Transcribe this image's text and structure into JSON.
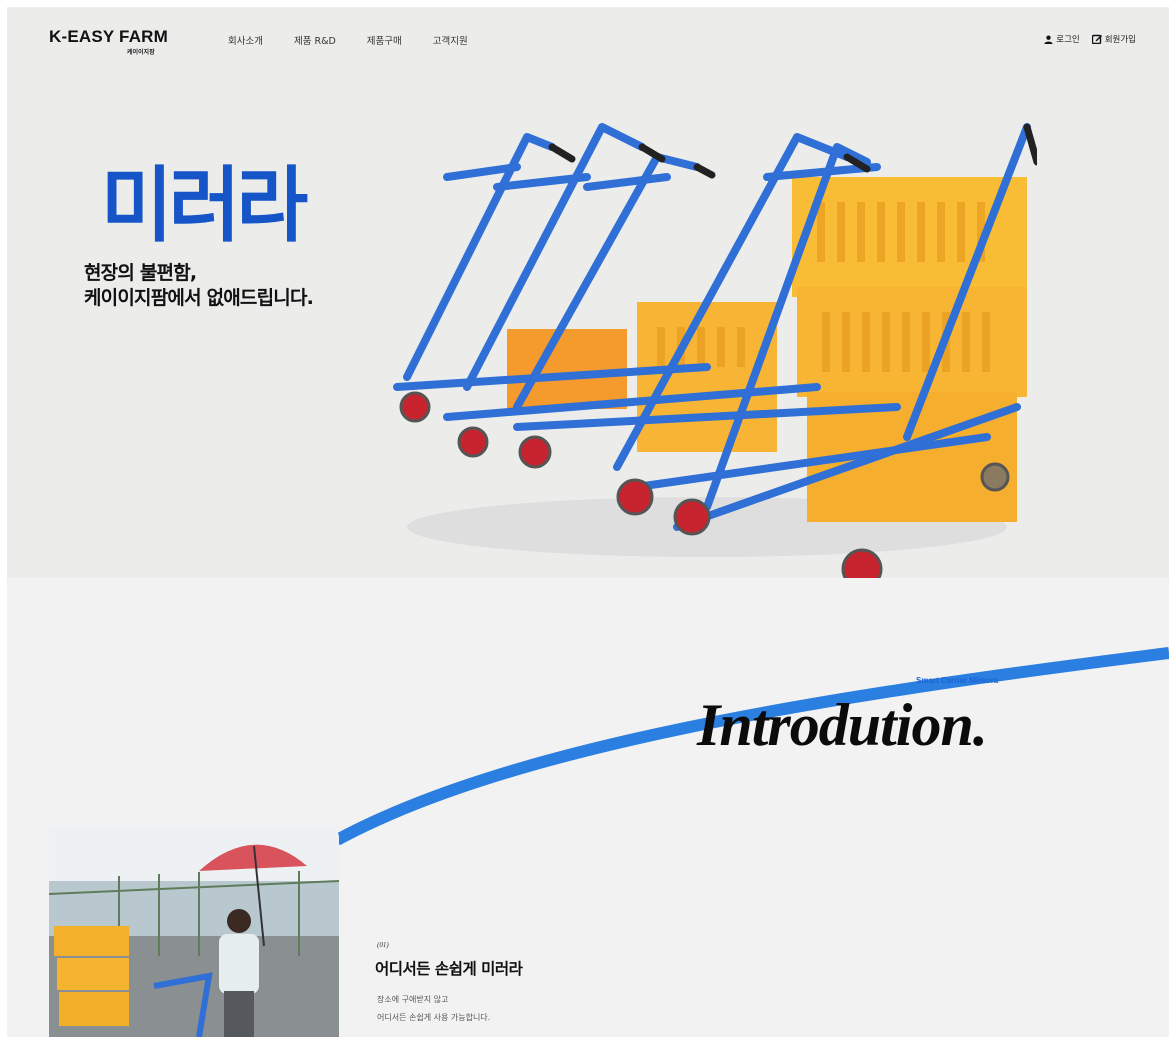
{
  "header": {
    "logo_main": "K-EASY FARM",
    "logo_sub": "케이이지팜",
    "nav": [
      "회사소개",
      "제품 R&D",
      "제품구매",
      "고객지원"
    ],
    "login_label": "로그인",
    "signup_label": "회원가입"
  },
  "hero": {
    "title": "미러라",
    "copy_line1": "현장의 불편함,",
    "copy_line2": "케이이지팜에서 없애드립니다.",
    "title_color": "#1555c8"
  },
  "intro": {
    "eyebrow": "Smart Carrier Mireora",
    "title": "Introdution.",
    "feature": {
      "number": "(01)",
      "title": "어디서든 손쉽게 미러라",
      "desc_line1": "장소에 구애받지 않고",
      "desc_line2": "어디서든 손쉽게 사용 가능합니다."
    },
    "arc_color": "#2a7fe0"
  },
  "icons": {
    "login": "user-icon",
    "signup": "edit-icon"
  }
}
